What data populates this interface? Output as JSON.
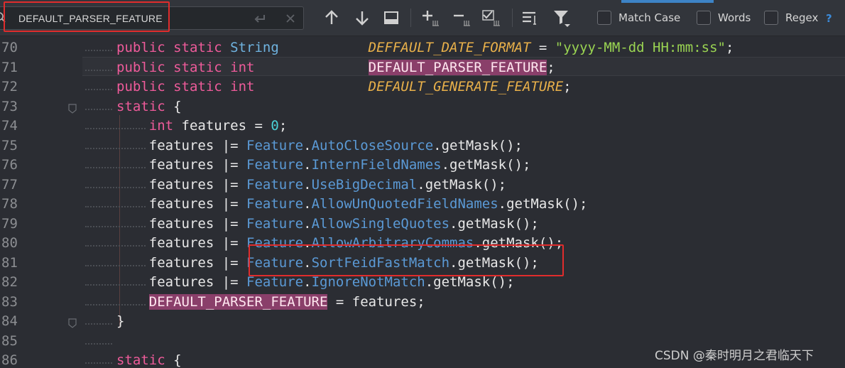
{
  "search": {
    "query": "DEFAULT_PARSER_FEATURE",
    "options": [
      {
        "label": "Match Case"
      },
      {
        "label": "Words"
      },
      {
        "label": "Regex"
      }
    ],
    "help": "?"
  },
  "code": {
    "line_numbers": [
      "70",
      "71",
      "72",
      "73",
      "74",
      "75",
      "76",
      "77",
      "78",
      "79",
      "80",
      "81",
      "82",
      "83",
      "84",
      "85",
      "86"
    ],
    "lines": [
      {
        "segments": [
          {
            "t": "public static ",
            "c": "kw"
          },
          {
            "t": "String",
            "c": "ty"
          },
          {
            "t": "           ",
            "c": ""
          },
          {
            "t": "DEFFAULT_DATE_FORMAT",
            "c": "cst"
          },
          {
            "t": " = ",
            "c": ""
          },
          {
            "t": "\"yyyy-MM-dd HH:mm:ss\"",
            "c": "str"
          },
          {
            "t": ";",
            "c": ""
          }
        ]
      },
      {
        "segments": [
          {
            "t": "public static int",
            "c": "kw"
          },
          {
            "t": "              ",
            "c": ""
          },
          {
            "t": "DEFAULT_PARSER_FEATURE",
            "c": "match"
          },
          {
            "t": ";",
            "c": ""
          }
        ]
      },
      {
        "segments": [
          {
            "t": "public static int",
            "c": "kw"
          },
          {
            "t": "              ",
            "c": ""
          },
          {
            "t": "DEFAULT_GENERATE_FEATURE",
            "c": "cst"
          },
          {
            "t": ";",
            "c": ""
          }
        ]
      },
      {
        "segments": [
          {
            "t": "static",
            "c": "kw"
          },
          {
            "t": " {",
            "c": ""
          }
        ]
      },
      {
        "segments": [
          {
            "t": "    ",
            "c": ""
          },
          {
            "t": "int",
            "c": "kw"
          },
          {
            "t": " features = ",
            "c": ""
          },
          {
            "t": "0",
            "c": "num"
          },
          {
            "t": ";",
            "c": ""
          }
        ]
      },
      {
        "segments": [
          {
            "t": "    features |= ",
            "c": ""
          },
          {
            "t": "Feature",
            "c": "feat"
          },
          {
            "t": ".",
            "c": ""
          },
          {
            "t": "AutoCloseSource",
            "c": "feat"
          },
          {
            "t": ".getMask();",
            "c": ""
          }
        ]
      },
      {
        "segments": [
          {
            "t": "    features |= ",
            "c": ""
          },
          {
            "t": "Feature",
            "c": "feat"
          },
          {
            "t": ".",
            "c": ""
          },
          {
            "t": "InternFieldNames",
            "c": "feat"
          },
          {
            "t": ".getMask();",
            "c": ""
          }
        ]
      },
      {
        "segments": [
          {
            "t": "    features |= ",
            "c": ""
          },
          {
            "t": "Feature",
            "c": "feat"
          },
          {
            "t": ".",
            "c": ""
          },
          {
            "t": "UseBigDecimal",
            "c": "feat"
          },
          {
            "t": ".getMask();",
            "c": ""
          }
        ]
      },
      {
        "segments": [
          {
            "t": "    features |= ",
            "c": ""
          },
          {
            "t": "Feature",
            "c": "feat"
          },
          {
            "t": ".",
            "c": ""
          },
          {
            "t": "AllowUnQuotedFieldNames",
            "c": "feat"
          },
          {
            "t": ".getMask();",
            "c": ""
          }
        ]
      },
      {
        "segments": [
          {
            "t": "    features |= ",
            "c": ""
          },
          {
            "t": "Feature",
            "c": "feat"
          },
          {
            "t": ".",
            "c": ""
          },
          {
            "t": "AllowSingleQuotes",
            "c": "feat"
          },
          {
            "t": ".getMask();",
            "c": ""
          }
        ]
      },
      {
        "segments": [
          {
            "t": "    features |= ",
            "c": ""
          },
          {
            "t": "Feature",
            "c": "feat"
          },
          {
            "t": ".",
            "c": ""
          },
          {
            "t": "AllowArbitraryCommas",
            "c": "feat"
          },
          {
            "t": ".getMask();",
            "c": ""
          }
        ]
      },
      {
        "segments": [
          {
            "t": "    features |= ",
            "c": ""
          },
          {
            "t": "Feature",
            "c": "feat"
          },
          {
            "t": ".",
            "c": ""
          },
          {
            "t": "SortFeidFastMatch",
            "c": "feat"
          },
          {
            "t": ".getMask();",
            "c": ""
          }
        ]
      },
      {
        "segments": [
          {
            "t": "    features |= ",
            "c": ""
          },
          {
            "t": "Feature",
            "c": "feat"
          },
          {
            "t": ".",
            "c": ""
          },
          {
            "t": "IgnoreNotMatch",
            "c": "feat"
          },
          {
            "t": ".getMask();",
            "c": ""
          }
        ]
      },
      {
        "segments": [
          {
            "t": "    ",
            "c": ""
          },
          {
            "t": "DEFAULT_PARSER_FEATURE",
            "c": "match"
          },
          {
            "t": " = features;",
            "c": ""
          }
        ]
      },
      {
        "segments": [
          {
            "t": "}",
            "c": ""
          }
        ]
      },
      {
        "segments": []
      },
      {
        "segments": [
          {
            "t": "static",
            "c": "kw"
          },
          {
            "t": " {",
            "c": ""
          }
        ]
      }
    ]
  },
  "watermark": "CSDN @秦时明月之君临天下",
  "colors": {
    "background": "#2b2d33",
    "keyword": "#ee5b9a",
    "constant": "#e8b04a",
    "string": "#9ad452",
    "feature": "#5b9ad6",
    "match_highlight": "#8a3f6a",
    "annotation_box": "#e02c2c"
  }
}
